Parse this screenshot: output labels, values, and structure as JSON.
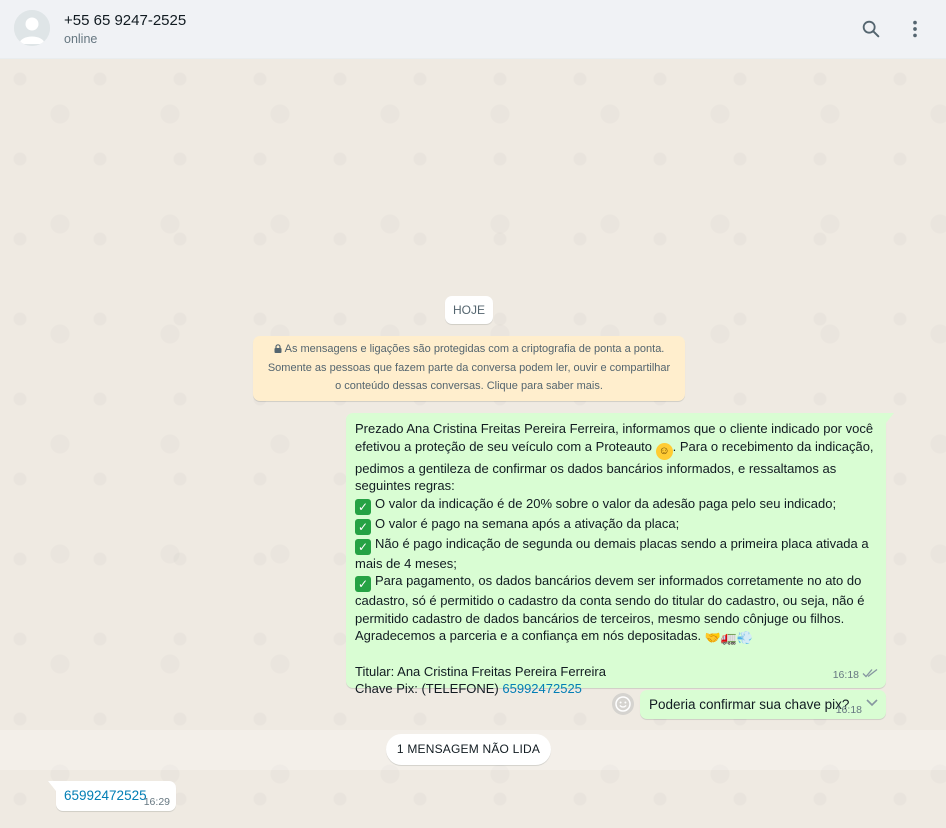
{
  "header": {
    "contact_name": "+55 65 9247-2525",
    "status": "online",
    "search_icon": "search-icon",
    "menu_icon": "kebab-menu-icon"
  },
  "chat": {
    "date_chip": "HOJE",
    "encryption_notice": {
      "line1": "As mensagens e ligações são protegidas com a criptografia de ponta a ponta.",
      "line2": "Somente as pessoas que fazem parte da conversa podem ler, ouvir e compartilhar",
      "line3": "o conteúdo dessas conversas. Clique para saber mais."
    },
    "outgoing_message": {
      "intro_a": "Prezado Ana Cristina Freitas Pereira Ferreira, informamos que o cliente indicado por você efetivou a proteção de seu veículo com a Proteauto ",
      "intro_b": ". Para o recebimento da indicação, pedimos a gentileza de confirmar os dados bancários informados, e  ressaltamos as seguintes regras:",
      "rule1": "O valor da indicação é de 20% sobre o valor da adesão paga pelo seu indicado;",
      "rule2": "O valor é pago na semana após a ativação da placa;",
      "rule3": "Não é pago indicação de segunda ou demais placas sendo a primeira placa ativada a mais de 4 meses;",
      "rule4": "Para pagamento, os dados bancários devem ser informados corretamente no ato do cadastro, só é permitido o cadastro da conta sendo do titular do cadastro, ou seja, não é permitido cadastro de dados bancários de terceiros, mesmo sendo cônjuge ou filhos.",
      "thanks": "Agradecemos a parceria e a confiança em nós depositadas. ",
      "holder": "Titular: Ana Cristina Freitas Pereira Ferreira",
      "pix_label": "Chave Pix: (TELEFONE) ",
      "pix_value": "65992472525",
      "time": "16:18",
      "status": "read-double-tick"
    },
    "outgoing_message_2": {
      "text": "Poderia confirmar sua chave pix?",
      "time": "16:18",
      "status": "delivered-double-tick"
    },
    "unread_chip": "1 MENSAGEM NÃO LIDA",
    "incoming_message": {
      "text": "65992472525",
      "time": "16:29"
    }
  },
  "colors": {
    "chat_bg": "#efeae2",
    "outgoing_bubble": "#d9fdd3",
    "incoming_bubble": "#ffffff",
    "notice_bg": "#ffeecd",
    "link": "#027eb5",
    "header_bg": "#f0f2f5"
  }
}
